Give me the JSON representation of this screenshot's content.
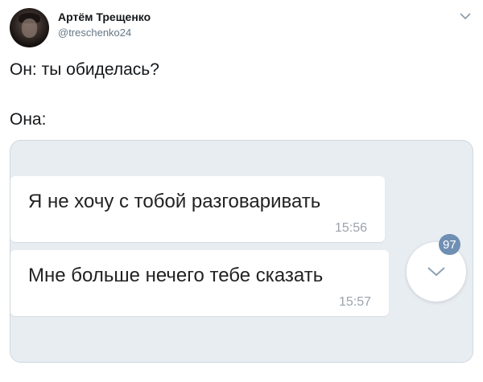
{
  "tweet": {
    "author_name": "Артём Трещенко",
    "author_handle": "@treschenko24",
    "text_line1": "Он: ты обиделась?",
    "text_line2": "Она:"
  },
  "screenshot": {
    "messages": [
      {
        "text": "Я не хочу с тобой разговаривать",
        "time": "15:56"
      },
      {
        "text": "Мне больше нечего тебе сказать",
        "time": "15:57"
      }
    ],
    "unread_count": "97"
  },
  "colors": {
    "card_background": "#e8edf2",
    "badge": "#6f8fb3",
    "handle_gray": "#657786"
  },
  "icons": [
    "avatar",
    "chevron-down-icon",
    "scroll-down-icon"
  ]
}
